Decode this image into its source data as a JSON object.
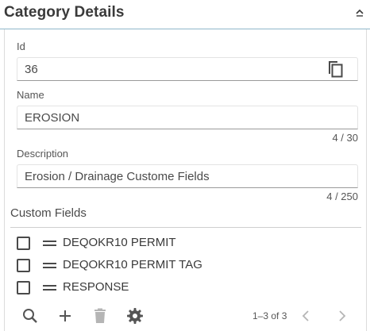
{
  "header": {
    "title": "Category Details"
  },
  "fields": {
    "id": {
      "label": "Id",
      "value": "36"
    },
    "name": {
      "label": "Name",
      "value": "EROSION",
      "counter": "4 / 30"
    },
    "description": {
      "label": "Description",
      "value": "Erosion / Drainage Custome Fields",
      "counter": "4 / 250"
    }
  },
  "custom_fields": {
    "title": "Custom Fields",
    "items": [
      {
        "label": "DEQOKR10 PERMIT",
        "checked": false
      },
      {
        "label": "DEQOKR10 PERMIT TAG",
        "checked": false
      },
      {
        "label": "RESPONSE",
        "checked": false
      }
    ]
  },
  "pager": {
    "range": "1–3 of 3"
  },
  "icons": {
    "collapse": "chevron-up-icon",
    "copy": "copy-icon",
    "search": "search-icon",
    "add": "plus-icon",
    "delete": "trash-icon",
    "settings": "gear-icon",
    "prev": "chevron-left-icon",
    "next": "chevron-right-icon"
  },
  "colors": {
    "header_border": "#8fb7c9",
    "text": "#3a3a3a",
    "icon": "#555555",
    "icon_disabled": "#b5b5b5"
  }
}
